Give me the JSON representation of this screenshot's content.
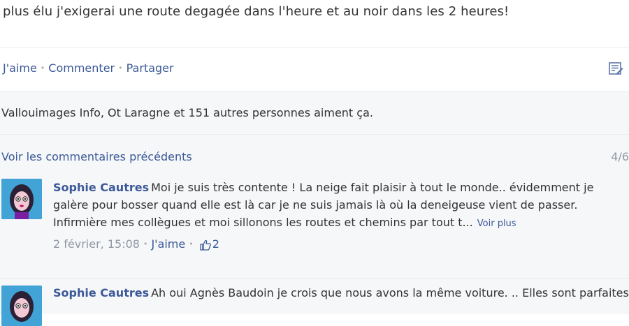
{
  "post": {
    "text": "plus élu j'exigerai une route degagée dans l'heure et au noir dans les 2 heures!"
  },
  "actions": {
    "like": "J'aime",
    "comment": "Commenter",
    "share": "Partager",
    "icon": "note-icon"
  },
  "likes": {
    "text": "Vallouimages Info, Ot Laragne et 151 autres personnes aiment ça."
  },
  "previous": {
    "link": "Voir les commentaires précédents",
    "count": "4/6"
  },
  "comments": [
    {
      "author": "Sophie Cautres",
      "text": "Moi je suis très contente ! La neige fait plaisir à tout le monde.. évidemment je galère pour bosser quand elle est là car je ne suis jamais là où la deneigeuse vient de passer. Infirmière mes collègues et moi sillonons les routes et chemins par tout t...",
      "see_more": "Voir plus",
      "date": "2 février, 15:08",
      "like": "J'aime",
      "like_count": "2"
    },
    {
      "author": "Sophie Cautres",
      "text": "Ah oui Agnès Baudoin je crois que nous avons la même voiture. .. Elles sont parfaites"
    }
  ],
  "colors": {
    "link": "#3b5998",
    "muted": "#9197a3",
    "comment_bg": "#f6f7f9"
  }
}
